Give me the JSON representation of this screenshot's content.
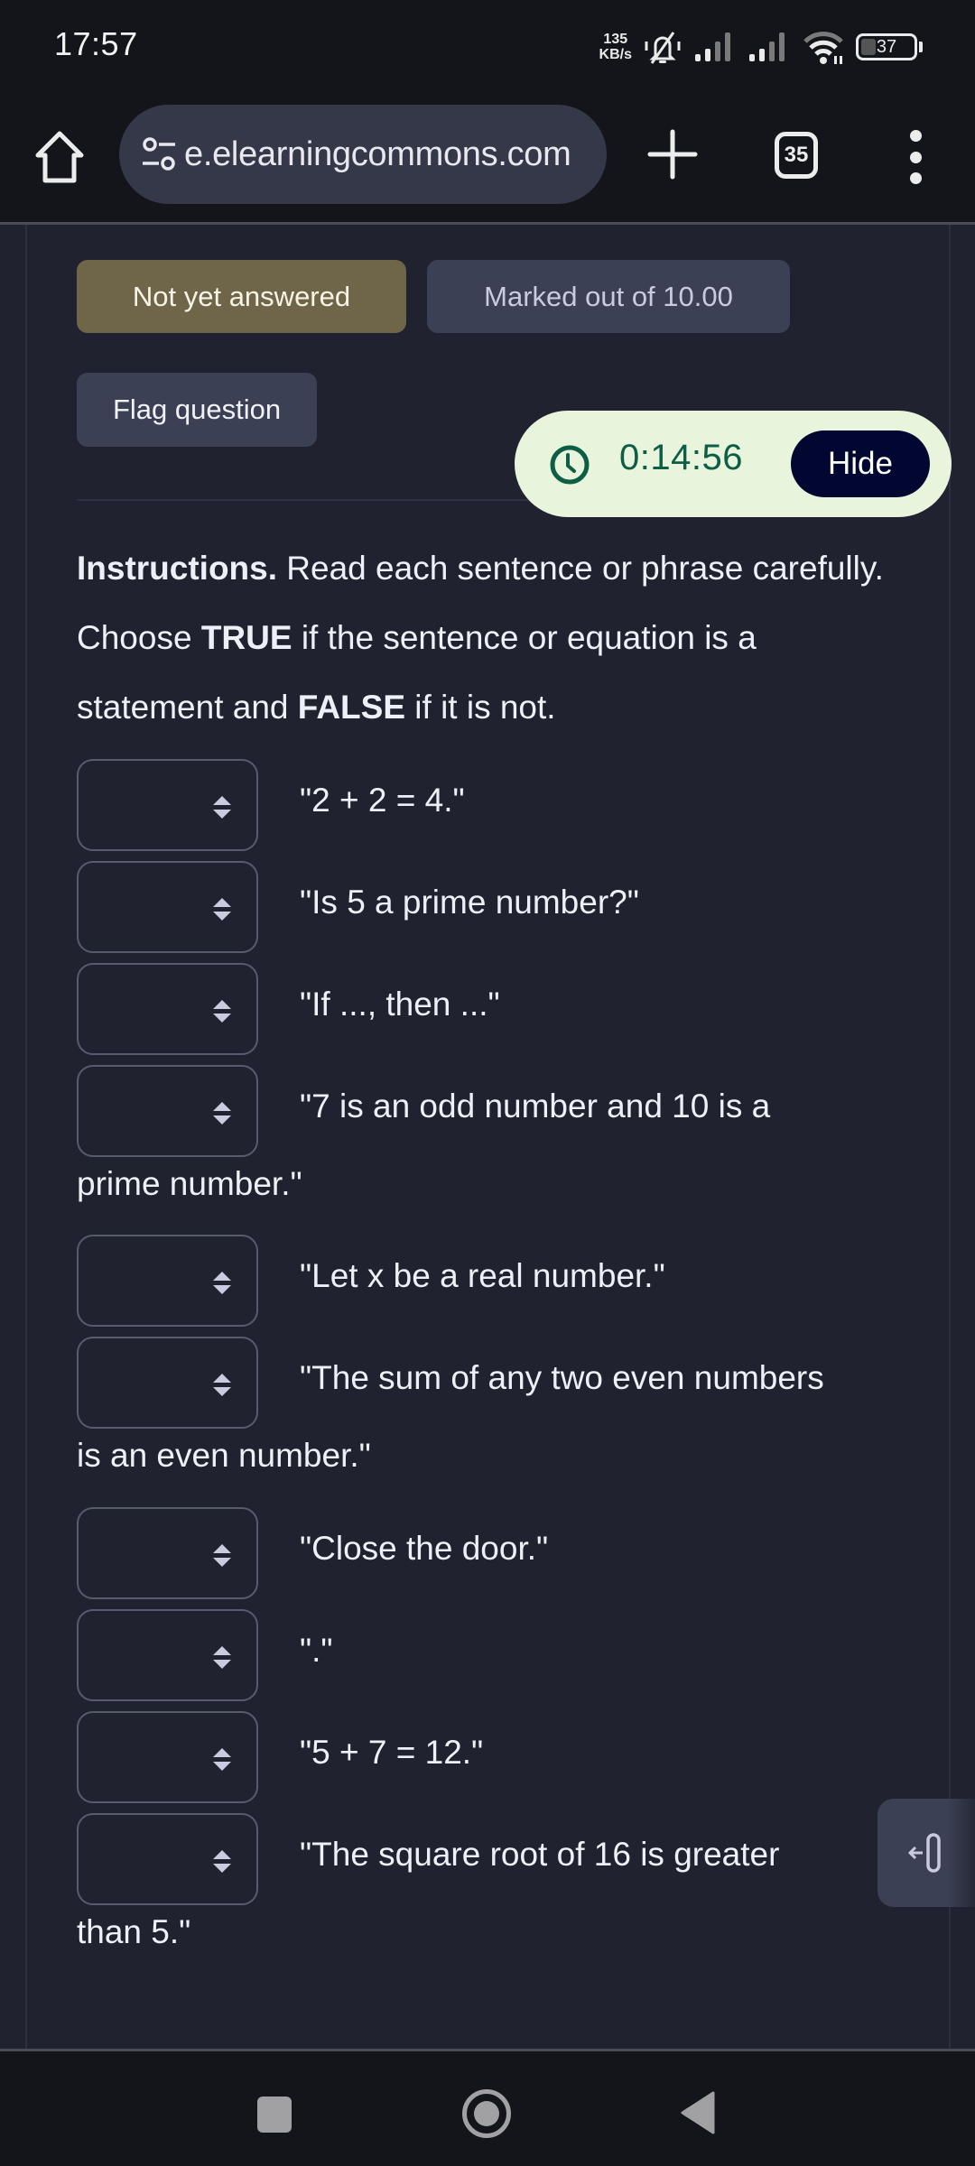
{
  "status_bar": {
    "time": "17:57",
    "net_speed_value": "135",
    "net_speed_unit": "KB/s",
    "icons": [
      "silent-bell-icon",
      "signal-icon",
      "signal-icon",
      "wifi-icon"
    ],
    "battery_level": "37"
  },
  "browser": {
    "url": "e.elearningcommons.com",
    "tab_count": "35",
    "icons": {
      "home": "home-icon",
      "site_settings": "tune-icon",
      "new_tab": "plus-icon",
      "tabs": "tab-switcher-icon",
      "menu": "more-vert-icon"
    }
  },
  "question": {
    "state": "Not yet answered",
    "marks": "Marked out of 10.00",
    "flag_label": "Flag question",
    "colors": {
      "state_badge": "#6f6549",
      "marks_badge": "#3c4054",
      "background": "#20232f"
    }
  },
  "timer": {
    "time_left": "0:14:56",
    "hide_label": "Hide",
    "colors": {
      "background": "#e8f4dc",
      "text": "#0d5e45",
      "button": "#020731"
    }
  },
  "instructions": {
    "lead": "Instructions.",
    "part1": " Read each sentence or phrase carefully. Choose ",
    "true_word": "TRUE",
    "part2": " if the sentence or equation is a statement and ",
    "false_word": "FALSE",
    "part3": " if it is not."
  },
  "items": [
    {
      "text": "\"2 + 2 = 4.\"",
      "selected": ""
    },
    {
      "text": "\"Is 5 a prime number?\"",
      "selected": ""
    },
    {
      "text": "\"If ..., then ...\"",
      "selected": ""
    },
    {
      "text": "\"7 is an odd number and 10 is a",
      "text_cont": "prime number.\"",
      "selected": ""
    },
    {
      "text": "\"Let x be a real number.\"",
      "selected": ""
    },
    {
      "text": "\"The sum of any two even numbers",
      "text_cont": "is an even number.\"",
      "selected": ""
    },
    {
      "text": "\"Close the door.\"",
      "selected": ""
    },
    {
      "text": "\".\"",
      "selected": ""
    },
    {
      "text": "\"5 + 7 = 12.\"",
      "selected": ""
    },
    {
      "text": "\"The square root of 16 is greater",
      "text_cont": "than 5.\"",
      "selected": ""
    }
  ],
  "side_drawer": {
    "icon": "open-drawer-icon"
  },
  "nav_bar": {
    "icons": [
      "recents-icon",
      "home-circle-icon",
      "back-icon"
    ]
  }
}
